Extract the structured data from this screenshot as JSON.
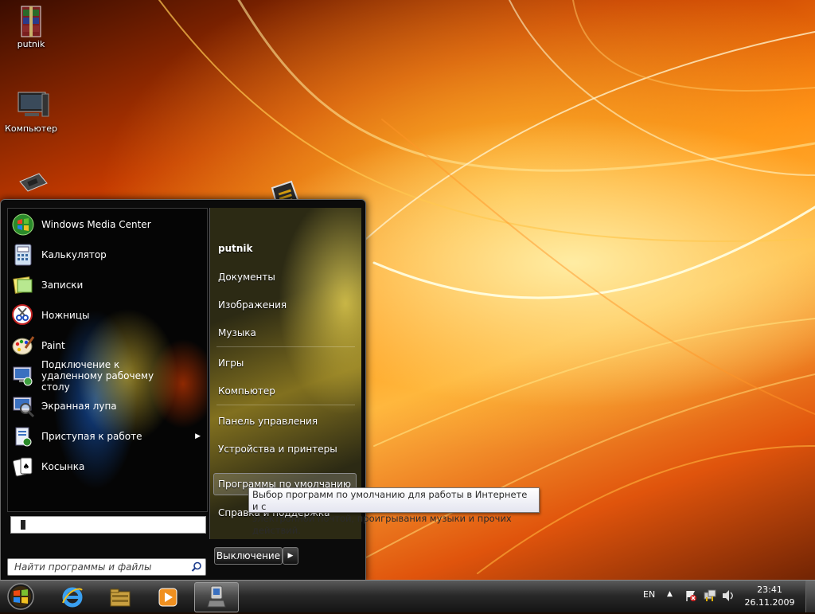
{
  "desktop": {
    "icons": [
      {
        "label": "putnik",
        "icon": "winrar-archive-icon"
      },
      {
        "label": "Компьютер",
        "icon": "computer-icon"
      },
      {
        "label": "",
        "icon": "recycle-bin-icon"
      }
    ]
  },
  "start_menu": {
    "programs": [
      {
        "label": "Windows Media Center",
        "icon": "media-center-icon",
        "has_submenu": false
      },
      {
        "label": "Калькулятор",
        "icon": "calculator-icon",
        "has_submenu": false
      },
      {
        "label": "Записки",
        "icon": "sticky-notes-icon",
        "has_submenu": false
      },
      {
        "label": "Ножницы",
        "icon": "snipping-tool-icon",
        "has_submenu": false
      },
      {
        "label": "Paint",
        "icon": "paint-icon",
        "has_submenu": false
      },
      {
        "label": "Подключение к удаленному рабочему столу",
        "icon": "remote-desktop-icon",
        "has_submenu": false
      },
      {
        "label": "Экранная лупа",
        "icon": "magnifier-icon",
        "has_submenu": false
      },
      {
        "label": "Приступая к работе",
        "icon": "getting-started-icon",
        "has_submenu": true
      },
      {
        "label": "Косынка",
        "icon": "solitaire-icon",
        "has_submenu": false
      }
    ],
    "search_placeholder": "Найти программы и файлы",
    "right_items": [
      {
        "label": "putnik"
      },
      {
        "label": "Документы"
      },
      {
        "label": "Изображения"
      },
      {
        "label": "Музыка"
      },
      {
        "label": "Игры"
      },
      {
        "label": "Компьютер"
      },
      {
        "label": "Панель управления"
      },
      {
        "label": "Устройства и принтеры"
      },
      {
        "label": "Программы по умолчанию"
      },
      {
        "label": "Справка и поддержка"
      }
    ],
    "highlighted_item": "Программы по умолчанию",
    "shutdown_label": "Выключение"
  },
  "tooltip": {
    "line1": "Выбор программ по умолчанию для работы в Интернете и с",
    "line2": "электронной почтой, проигрывания музыки и прочих действий."
  },
  "taskbar": {
    "pinned": [
      {
        "name": "internet-explorer-icon"
      },
      {
        "name": "file-manager-icon"
      },
      {
        "name": "media-player-icon"
      },
      {
        "name": "pinned-app-icon",
        "active": true
      }
    ],
    "language": "EN",
    "time": "23:41",
    "date": "26.11.2009"
  }
}
